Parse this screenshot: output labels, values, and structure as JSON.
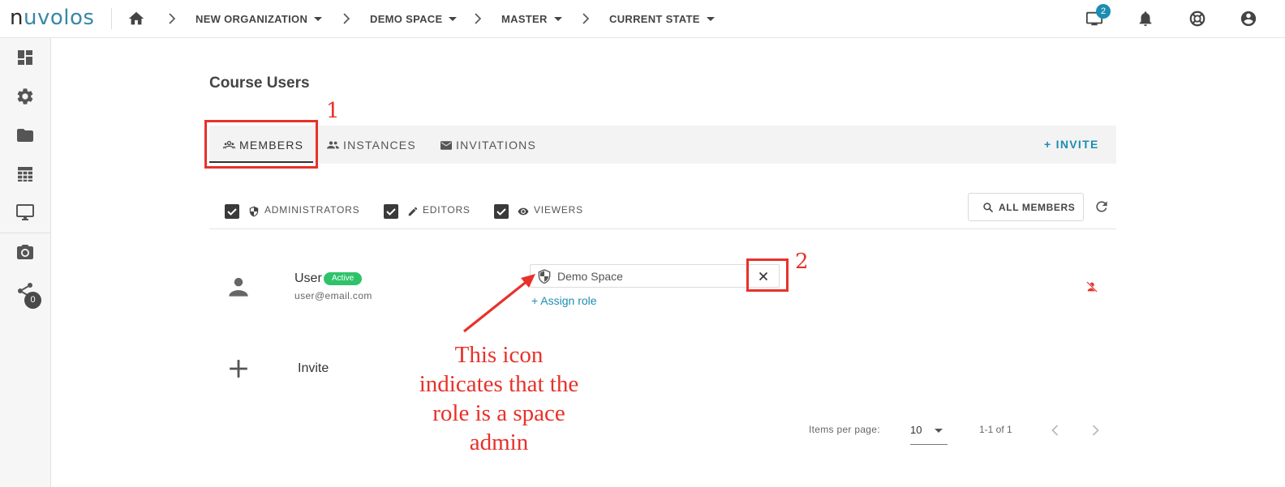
{
  "app": {
    "logo_n": "n",
    "logo_rest": "uvolos"
  },
  "breadcrumb": {
    "items": [
      {
        "label": "NEW ORGANIZATION"
      },
      {
        "label": "DEMO SPACE"
      },
      {
        "label": "MASTER"
      },
      {
        "label": "CURRENT STATE"
      }
    ]
  },
  "topbar": {
    "notifications_badge": "2"
  },
  "sidebar": {
    "share_count": "0"
  },
  "page": {
    "title": "Course Users"
  },
  "tabs": [
    {
      "label": "MEMBERS",
      "active": true
    },
    {
      "label": "INSTANCES"
    },
    {
      "label": "INVITATIONS"
    }
  ],
  "invite_button": "+ INVITE",
  "filters": [
    {
      "label": "ADMINISTRATORS",
      "checked": true
    },
    {
      "label": "EDITORS",
      "checked": true
    },
    {
      "label": "VIEWERS",
      "checked": true
    }
  ],
  "all_members_button": "ALL MEMBERS",
  "members": [
    {
      "name": "User",
      "status": "Active",
      "email": "user@email.com",
      "role": "Demo Space",
      "assign_role_label": "+ Assign role"
    }
  ],
  "invite_row_label": "Invite",
  "pagination": {
    "items_per_page_label": "Items per page:",
    "items_per_page_value": "10",
    "range": "1-1 of 1"
  },
  "annotations": {
    "tab_marker": "1",
    "remove_marker": "2",
    "note_lines": [
      "This icon",
      "indicates that the",
      "role is a space",
      "admin"
    ]
  },
  "colors": {
    "accent": "#1b8db2",
    "status_active": "#2ec36b",
    "annotation": "#e8312a"
  }
}
